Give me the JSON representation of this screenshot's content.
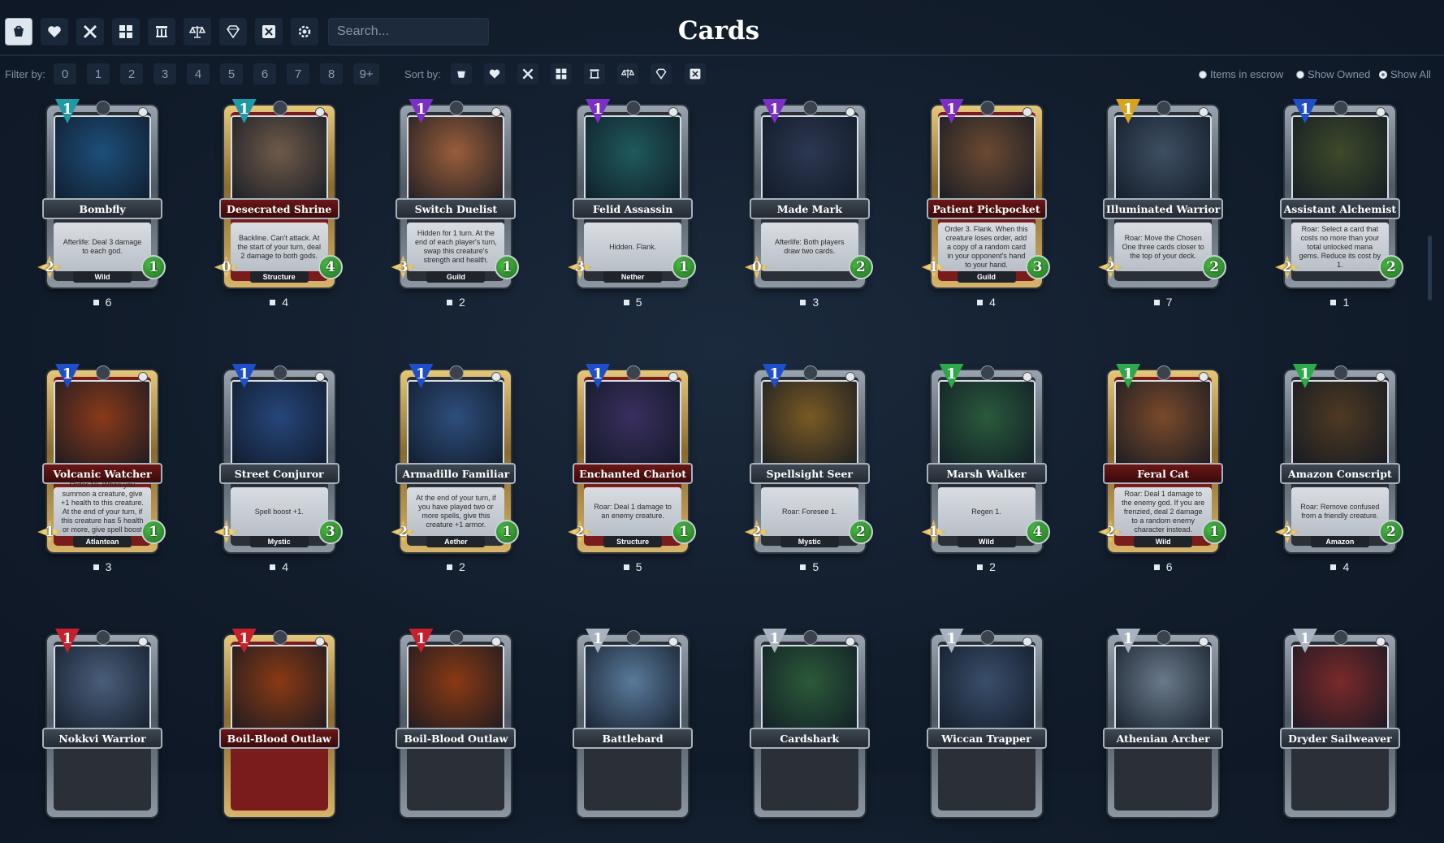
{
  "header": {
    "title": "Cards",
    "search_placeholder": "Search...",
    "toolbar_icons": [
      "bucket-icon",
      "heart-icon",
      "crossed-swords-icon",
      "cubes-icon",
      "temple-icon",
      "scales-icon",
      "gem-icon",
      "x-box-icon",
      "gear-icon"
    ]
  },
  "filter": {
    "label": "Filter by:",
    "options": [
      "0",
      "1",
      "2",
      "3",
      "4",
      "5",
      "6",
      "7",
      "8",
      "9+"
    ]
  },
  "sort": {
    "label": "Sort by:",
    "icons": [
      "bucket-icon",
      "heart-icon",
      "crossed-swords-icon",
      "cubes-icon",
      "temple-icon",
      "scales-icon",
      "gem-icon",
      "x-box-icon"
    ]
  },
  "view": {
    "options": [
      "Items in escrow",
      "Show Owned",
      "Show All"
    ],
    "selected": "Show All"
  },
  "colors": {
    "background": "#121d2c",
    "god_war": "#c5202b",
    "god_nature": "#2da84a",
    "god_deception": "#7b2fc4",
    "god_magic": "#1e4fc9",
    "god_light": "#d6a31f",
    "god_death": "#1e9aa6",
    "god_neutral": "#a9b3bf"
  },
  "cards": [
    {
      "name": "Bombfly",
      "text": "Afterlife: Deal 3 damage to each god.",
      "tribe": "Wild",
      "mana": "1",
      "attack": "2",
      "health": "1",
      "count": "6",
      "god": "death",
      "rarity": "silver",
      "art": "#1d4f7a"
    },
    {
      "name": "Desecrated Shrine",
      "text": "Backline. Can't attack. At the start of your turn, deal 2 damage to both gods.",
      "tribe": "Structure",
      "mana": "1",
      "attack": "0",
      "health": "4",
      "count": "4",
      "god": "death",
      "rarity": "gold",
      "art": "#6f5a49"
    },
    {
      "name": "Switch Duelist",
      "text": "Hidden for 1 turn. At the end of each player's turn, swap this creature's strength and health.",
      "tribe": "Guild",
      "mana": "1",
      "attack": "3",
      "health": "1",
      "count": "2",
      "god": "deception",
      "rarity": "silver",
      "art": "#9a5e3a"
    },
    {
      "name": "Felid Assassin",
      "text": "Hidden. Flank.",
      "tribe": "Nether",
      "mana": "1",
      "attack": "3",
      "health": "1",
      "count": "5",
      "god": "deception",
      "rarity": "silver",
      "art": "#1f5a5c"
    },
    {
      "name": "Made Mark",
      "text": "Afterlife: Both players draw two cards.",
      "tribe": "",
      "mana": "1",
      "attack": "0",
      "health": "2",
      "count": "3",
      "god": "deception",
      "rarity": "silver",
      "art": "#2c3852"
    },
    {
      "name": "Patient Pickpocket",
      "text": "Order 3. Flank. When this creature loses order, add a copy of a random card in your opponent's hand to your hand.",
      "tribe": "Guild",
      "mana": "1",
      "attack": "1",
      "health": "3",
      "count": "4",
      "god": "deception",
      "rarity": "gold",
      "art": "#6b4a32"
    },
    {
      "name": "Illuminated Warrior",
      "text": "Roar: Move the Chosen One three cards closer to the top of your deck.",
      "tribe": "",
      "mana": "1",
      "attack": "2",
      "health": "2",
      "count": "7",
      "god": "light",
      "rarity": "silver",
      "art": "#3e4f63"
    },
    {
      "name": "Assistant Alchemist",
      "text": "Roar: Select a card that costs no more than your total unlocked mana gems. Reduce its cost by 1.",
      "tribe": "",
      "mana": "1",
      "attack": "2",
      "health": "2",
      "count": "1",
      "god": "magic",
      "rarity": "silver",
      "art": "#3e4a2a"
    },
    {
      "name": "Volcanic Watcher",
      "text": "Order 10. When you summon a creature, give +1 health to this creature. At the end of your turn, if this creature has 5 health or more, give spell boost +1 to it.",
      "tribe": "Atlantean",
      "mana": "1",
      "attack": "1",
      "health": "1",
      "count": "3",
      "god": "magic",
      "rarity": "gold",
      "art": "#8a3a1a"
    },
    {
      "name": "Street Conjuror",
      "text": "Spell boost +1.",
      "tribe": "Mystic",
      "mana": "1",
      "attack": "1",
      "health": "3",
      "count": "4",
      "god": "magic",
      "rarity": "silver",
      "art": "#26467a"
    },
    {
      "name": "Armadillo Familiar",
      "text": "At the end of your turn, if you have played two or more spells, give this creature +1 armor.",
      "tribe": "Aether",
      "mana": "1",
      "attack": "2",
      "health": "1",
      "count": "2",
      "god": "magic",
      "rarity": "gold",
      "art": "#2e4e7c"
    },
    {
      "name": "Enchanted Chariot",
      "text": "Roar: Deal 1 damage to an enemy creature.",
      "tribe": "Structure",
      "mana": "1",
      "attack": "2",
      "health": "1",
      "count": "5",
      "god": "magic",
      "rarity": "gold",
      "art": "#3a2f5e"
    },
    {
      "name": "Spellsight Seer",
      "text": "Roar: Foresee 1.",
      "tribe": "Mystic",
      "mana": "1",
      "attack": "2",
      "health": "2",
      "count": "5",
      "god": "magic",
      "rarity": "silver",
      "art": "#7a5a24"
    },
    {
      "name": "Marsh Walker",
      "text": "Regen 1.",
      "tribe": "Wild",
      "mana": "1",
      "attack": "1",
      "health": "4",
      "count": "2",
      "god": "nature",
      "rarity": "silver",
      "art": "#2a5a3c"
    },
    {
      "name": "Feral Cat",
      "text": "Roar: Deal 1 damage to the enemy god. If you are frenzied, deal 2 damage to a random enemy character instead.",
      "tribe": "Wild",
      "mana": "1",
      "attack": "2",
      "health": "1",
      "count": "6",
      "god": "nature",
      "rarity": "gold",
      "art": "#7a4a2a"
    },
    {
      "name": "Amazon Conscript",
      "text": "Roar: Remove confused from a friendly creature.",
      "tribe": "Amazon",
      "mana": "1",
      "attack": "2",
      "health": "2",
      "count": "4",
      "god": "nature",
      "rarity": "silver",
      "art": "#4e3a22"
    },
    {
      "name": "Nokkvi Warrior",
      "text": "",
      "tribe": "",
      "mana": "1",
      "attack": "",
      "health": "",
      "count": "",
      "god": "war",
      "rarity": "silver",
      "art": "#4a5e7a"
    },
    {
      "name": "Boil-Blood Outlaw",
      "text": "",
      "tribe": "",
      "mana": "1",
      "attack": "",
      "health": "",
      "count": "",
      "god": "war",
      "rarity": "gold",
      "art": "#8a3a14"
    },
    {
      "name": "Boil-Blood Outlaw",
      "text": "",
      "tribe": "",
      "mana": "1",
      "attack": "",
      "health": "",
      "count": "",
      "god": "war",
      "rarity": "silver",
      "art": "#8a3a14"
    },
    {
      "name": "Battlebard",
      "text": "",
      "tribe": "",
      "mana": "1",
      "attack": "",
      "health": "",
      "count": "",
      "god": "neutral",
      "rarity": "silver",
      "art": "#5a7a9a"
    },
    {
      "name": "Cardshark",
      "text": "",
      "tribe": "",
      "mana": "1",
      "attack": "",
      "health": "",
      "count": "",
      "god": "neutral",
      "rarity": "silver",
      "art": "#2c5a3a"
    },
    {
      "name": "Wiccan Trapper",
      "text": "",
      "tribe": "",
      "mana": "1",
      "attack": "",
      "health": "",
      "count": "",
      "god": "neutral",
      "rarity": "silver",
      "art": "#3a4e6a"
    },
    {
      "name": "Athenian Archer",
      "text": "",
      "tribe": "",
      "mana": "1",
      "attack": "",
      "health": "",
      "count": "",
      "god": "neutral",
      "rarity": "silver",
      "art": "#6a7a8a"
    },
    {
      "name": "Dryder Sailweaver",
      "text": "",
      "tribe": "",
      "mana": "1",
      "attack": "",
      "health": "",
      "count": "",
      "god": "neutral",
      "rarity": "silver",
      "art": "#7a2a2a"
    }
  ]
}
